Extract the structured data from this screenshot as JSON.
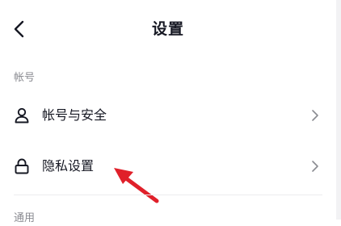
{
  "header": {
    "title": "设置",
    "back_icon": "chevron-left-icon"
  },
  "sections": {
    "account": {
      "label": "帐号"
    },
    "general": {
      "label": "通用"
    }
  },
  "rows": {
    "account_security": {
      "label": "帐号与安全",
      "icon": "user-icon"
    },
    "privacy": {
      "label": "隐私设置",
      "icon": "lock-icon"
    }
  },
  "colors": {
    "text_primary": "#161823",
    "text_secondary": "#8a8b91",
    "annotation_arrow": "#e0202a"
  }
}
